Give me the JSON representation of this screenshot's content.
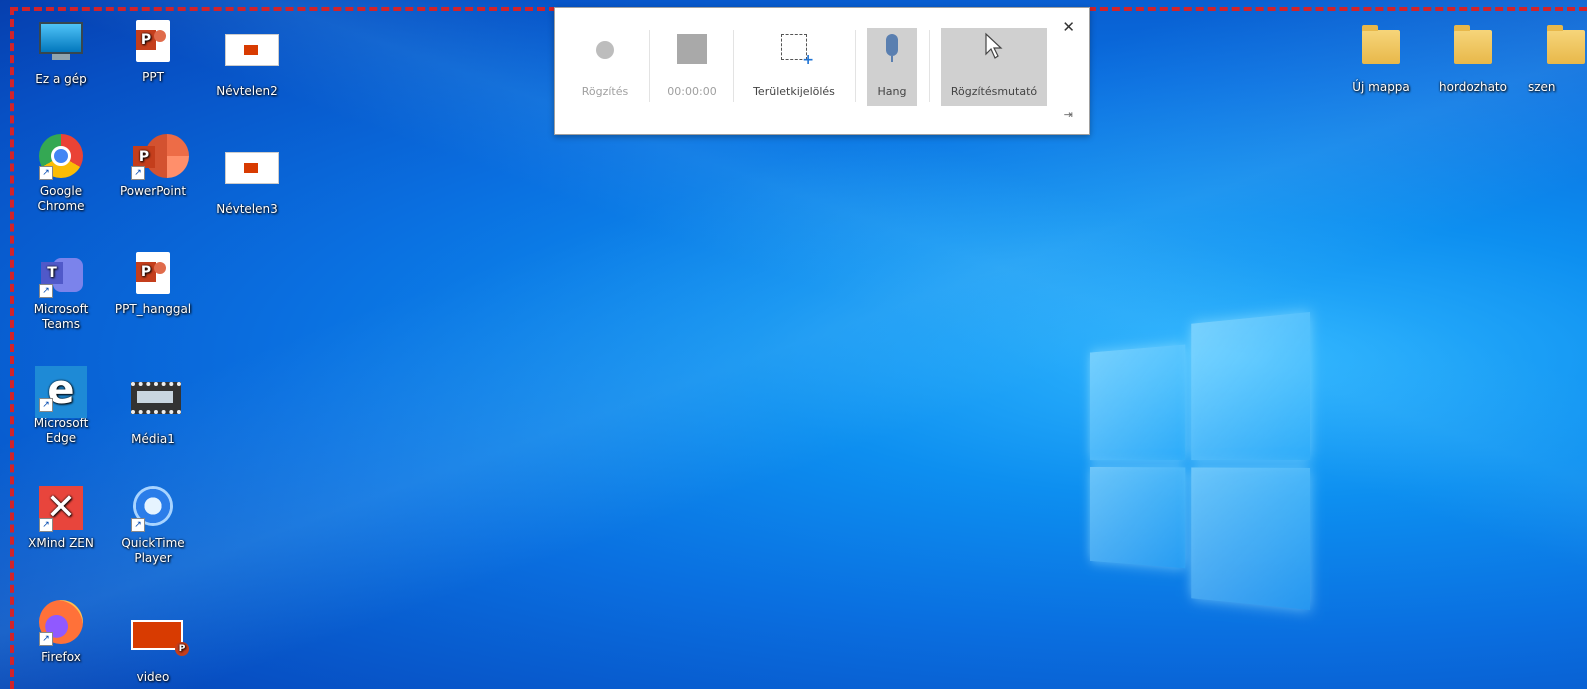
{
  "desktop": {
    "icons_left": [
      {
        "label": "Ez a gép",
        "icon": "computer-icon",
        "shortcut": false
      },
      {
        "label": "PPT",
        "icon": "powerpoint-file-icon",
        "shortcut": false
      },
      {
        "label": "Névtelen2",
        "icon": "slide-file-icon",
        "shortcut": false
      },
      {
        "label": "Google Chrome",
        "icon": "chrome-icon",
        "shortcut": true
      },
      {
        "label": "PowerPoint",
        "icon": "powerpoint-app-icon",
        "shortcut": true
      },
      {
        "label": "Névtelen3",
        "icon": "slide-file-icon",
        "shortcut": false
      },
      {
        "label": "Microsoft Teams",
        "icon": "teams-icon",
        "shortcut": true
      },
      {
        "label": "PPT_hanggal",
        "icon": "powerpoint-file-icon",
        "shortcut": false
      },
      {
        "label": "Microsoft Edge",
        "icon": "edge-icon",
        "shortcut": true
      },
      {
        "label": "Média1",
        "icon": "video-file-icon",
        "shortcut": false
      },
      {
        "label": "XMind ZEN",
        "icon": "xmind-icon",
        "shortcut": true
      },
      {
        "label": "QuickTime Player",
        "icon": "quicktime-icon",
        "shortcut": true
      },
      {
        "label": "Firefox",
        "icon": "firefox-icon",
        "shortcut": true
      },
      {
        "label": "video",
        "icon": "powerpoint-show-icon",
        "shortcut": false
      }
    ],
    "icons_right": [
      {
        "label": "Új mappa",
        "icon": "folder-icon"
      },
      {
        "label": "hordozhato",
        "icon": "folder-icon"
      },
      {
        "label": "szen",
        "icon": "folder-icon"
      }
    ]
  },
  "recording_toolbar": {
    "record_label": "Rögzítés",
    "timer": "00:00:00",
    "area_label": "Területkijelölés",
    "audio_label": "Hang",
    "pointer_label": "Rögzítésmutató",
    "close_glyph": "✕",
    "pin_glyph": "⇥"
  },
  "colors": {
    "selection_border": "#d2232a",
    "desktop_blue": "#0a6fe0"
  }
}
